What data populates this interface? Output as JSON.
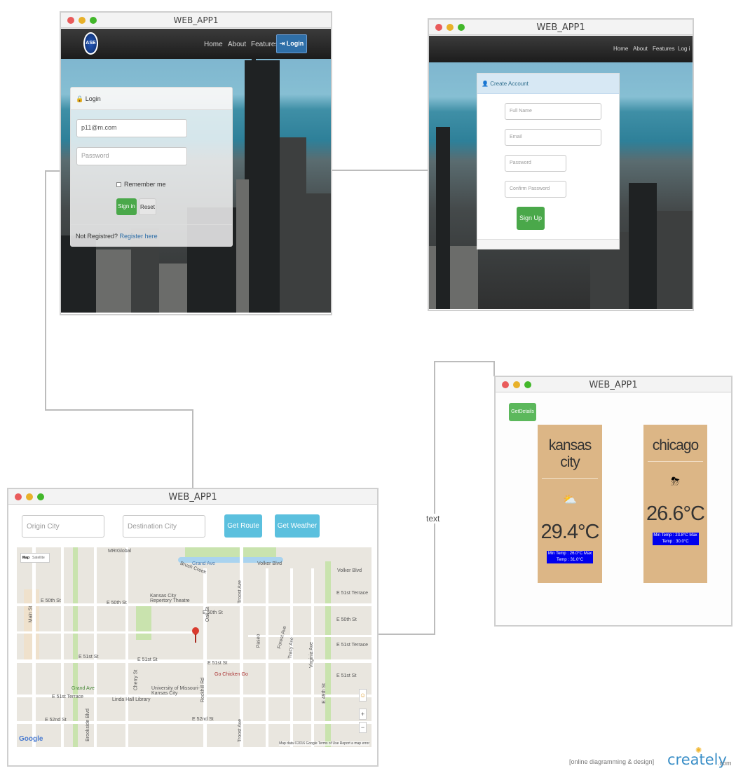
{
  "login_window": {
    "title": "WEB_APP1",
    "logo_text": "ASE",
    "nav": [
      "Home",
      "About",
      "Features"
    ],
    "login_button": "Login",
    "panel_title": "Login",
    "email_value": "p11@m.com",
    "password_placeholder": "Password",
    "remember_label": "Remember me",
    "signin_label": "Sign in",
    "reset_label": "Reset",
    "not_registered": "Not Registred?",
    "register_link": "Register here"
  },
  "signup_window": {
    "title": "WEB_APP1",
    "nav": [
      "Home",
      "About",
      "Features",
      "Log i"
    ],
    "panel_title": "Create Account",
    "fullname_placeholder": "Full Name",
    "email_placeholder": "Email",
    "password_placeholder": "Password",
    "confirm_placeholder": "Confirm Password",
    "signup_label": "Sign Up"
  },
  "map_window": {
    "title": "WEB_APP1",
    "origin_placeholder": "Origin City",
    "destination_placeholder": "Destination City",
    "route_button": "Get Route",
    "weather_button": "Get Weather",
    "map_toggle": [
      "Map",
      "Satellite"
    ],
    "map_labels": [
      "MRIGlobal",
      "Kansas City Repertory Theatre",
      "E 50th St",
      "E 51st St",
      "E 51st Terrace",
      "E 52nd St",
      "Go Chicken Go",
      "University of Missouri-Kansas City",
      "Linda Hall Library",
      "Troost Ave",
      "Rockhill Rd",
      "Oak St",
      "Main St",
      "Grand Ave",
      "Brush Creek",
      "Volker Blvd",
      "E 49th St",
      "Paseo",
      "Forest Ave",
      "Tracy Ave",
      "Virginia Ave",
      "Lydia Ave",
      "Brookside Blvd",
      "Cherry St",
      "Holmes St"
    ],
    "google": "Google",
    "map_footer": "Map data ©2016 Google   Terms of Use   Report a map error"
  },
  "weather_window": {
    "title": "WEB_APP1",
    "details_button": "GetDetails",
    "cards": [
      {
        "city": "kansas city",
        "temp": "29.4°C",
        "minmax": "Min Temp : 26.0°C Max Temp : 31.0°C"
      },
      {
        "city": "chicago",
        "temp": "26.6°C",
        "minmax": "Min Temp : 23.8°C Max Temp : 30.0°C"
      }
    ]
  },
  "connector_label": "text",
  "footer": {
    "tagline": "[online diagramming & design]",
    "brand": "creately",
    "brand_suffix": ".com"
  },
  "colors": {
    "green": "#4aa84a",
    "blue_button": "#5bc0de",
    "nav_login": "#2f6fa8",
    "card": "#dcb686"
  }
}
